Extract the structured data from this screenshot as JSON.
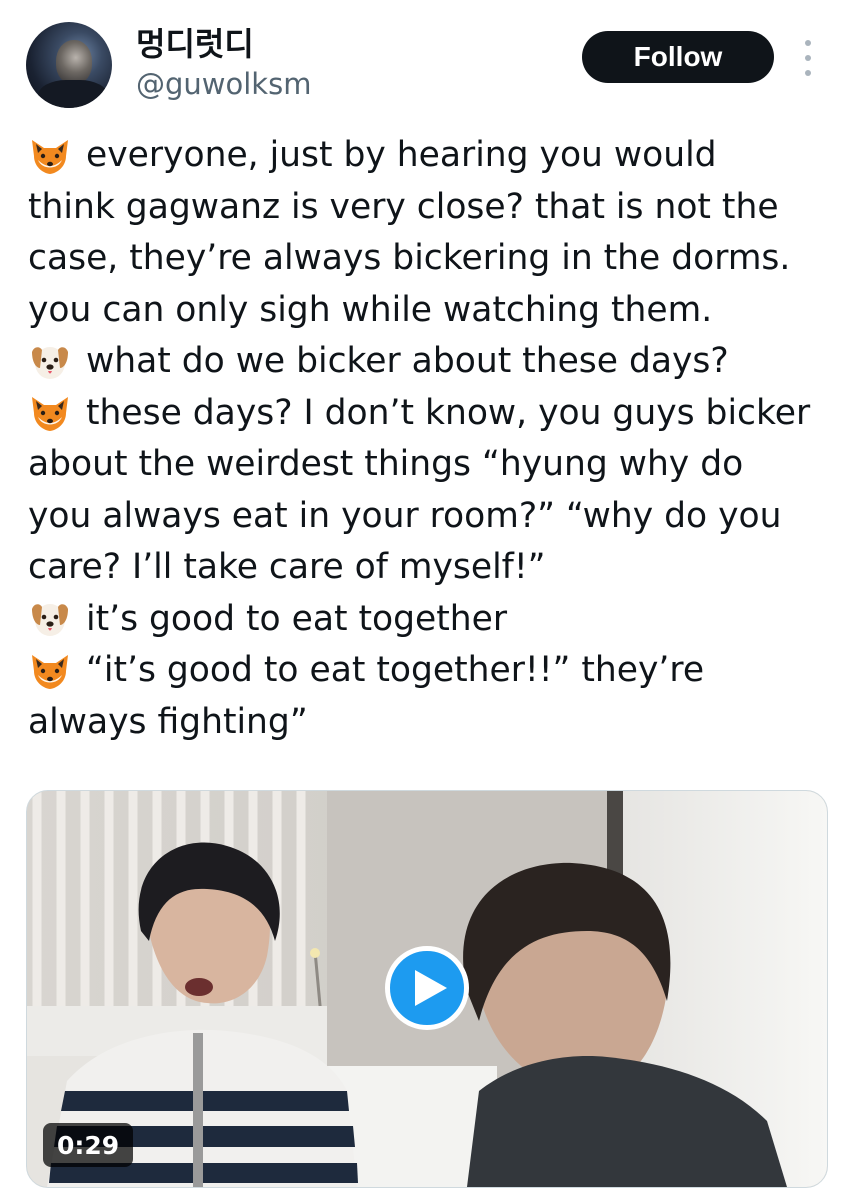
{
  "user": {
    "display_name": "멍디럿디",
    "handle": "@guwolksm"
  },
  "actions": {
    "follow_label": "Follow",
    "more_icon": "more-vertical-icon"
  },
  "tweet": {
    "lines": [
      {
        "emoji": "fox",
        "text": "everyone, just by hearing you would"
      },
      {
        "emoji": "",
        "text": "think gagwanz is very close? that is not the"
      },
      {
        "emoji": "",
        "text": "case, they’re always bickering in the dorms."
      },
      {
        "emoji": "",
        "text": "you can only sigh while watching them."
      },
      {
        "emoji": "dog",
        "text": "what do we bicker about these days?"
      },
      {
        "emoji": "fox",
        "text": "these days? I don’t know, you guys bicker"
      },
      {
        "emoji": "",
        "text": "about the weirdest things “hyung why do"
      },
      {
        "emoji": "",
        "text": "you always eat in your room?” “why do you"
      },
      {
        "emoji": "",
        "text": "care? I’ll take care of myself!”"
      },
      {
        "emoji": "dog",
        "text": "it’s good to eat together"
      },
      {
        "emoji": "fox",
        "text": "“it’s good to eat together!!” they’re"
      },
      {
        "emoji": "",
        "text": "always fighting”"
      }
    ]
  },
  "media": {
    "duration": "0:29",
    "play_icon": "play-icon"
  },
  "colors": {
    "text": "#0f1419",
    "secondary": "#536471",
    "button": "#0f1419",
    "play": "#1d9bf0"
  }
}
